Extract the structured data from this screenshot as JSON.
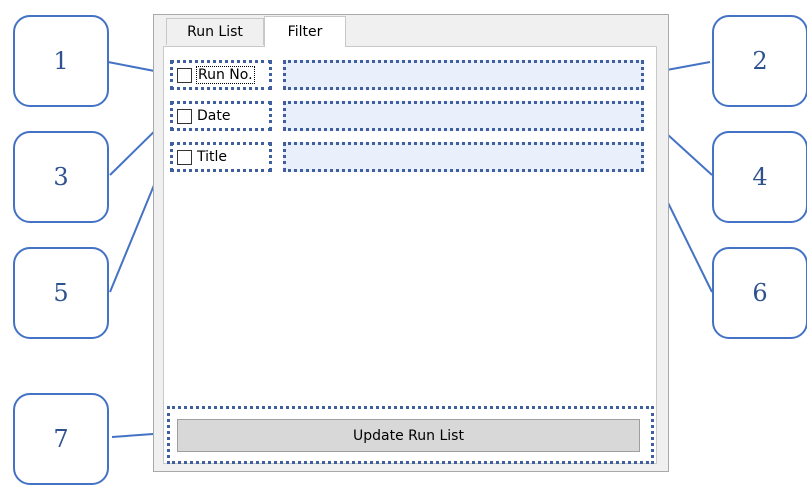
{
  "tabs": [
    {
      "label": "Run List"
    },
    {
      "label": "Filter"
    }
  ],
  "filter": {
    "rows": [
      {
        "label": "Run No.",
        "checked": false,
        "value": ""
      },
      {
        "label": "Date",
        "checked": false,
        "value": ""
      },
      {
        "label": "Title",
        "checked": false,
        "value": ""
      }
    ],
    "update_label": "Update Run List"
  },
  "callouts": [
    "1",
    "2",
    "3",
    "4",
    "5",
    "6",
    "7"
  ],
  "colors": {
    "highlight_border": "#3f5f9f",
    "callout_border": "#4472c4",
    "input_background": "#eaf0fb"
  }
}
